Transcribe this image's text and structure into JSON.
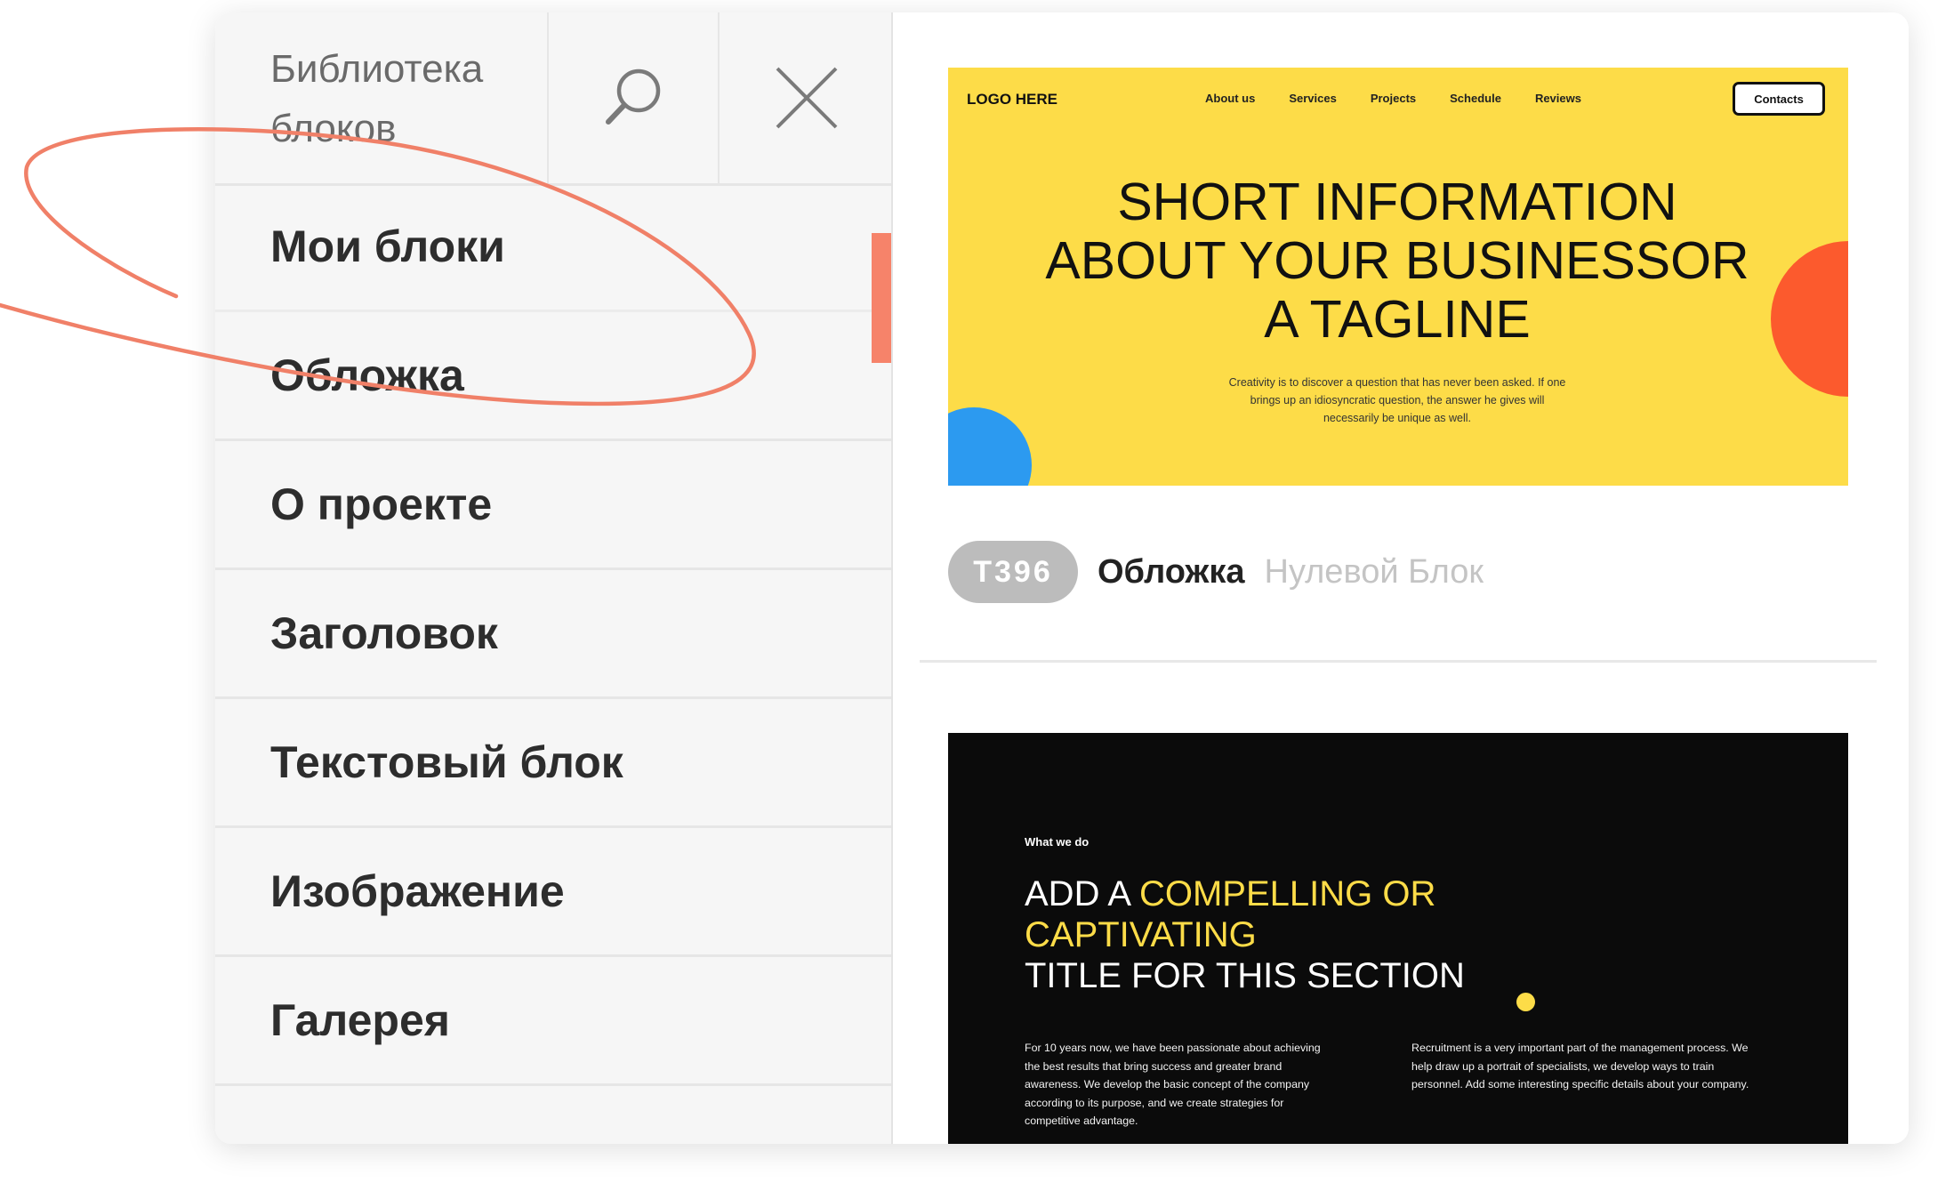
{
  "sidebar": {
    "title": "Библиотека блоков",
    "search_icon": "search-icon",
    "close_icon": "close-icon",
    "accent_color": "#f6836a",
    "items": [
      {
        "label": "Мои блоки",
        "active": true
      },
      {
        "label": "Обложка"
      },
      {
        "label": "О проекте"
      },
      {
        "label": "Заголовок"
      },
      {
        "label": "Текстовый блок"
      },
      {
        "label": "Изображение"
      },
      {
        "label": "Галерея"
      }
    ]
  },
  "blocks": [
    {
      "code": "T396",
      "title": "Обложка",
      "subtitle": "Нулевой Блок",
      "preview": {
        "logo": "LOGO HERE",
        "nav": [
          "About us",
          "Services",
          "Projects",
          "Schedule",
          "Reviews"
        ],
        "button": "Contacts",
        "headline": "SHORT INFORMATION ABOUT YOUR BUSINESSOR A TAGLINE",
        "description": "Creativity is to discover a question that has never been asked. If one brings up an idiosyncratic question, the answer he gives will necessarily be unique as well.",
        "colors": {
          "background": "#fddc48",
          "circle_orange": "#fc5a2d",
          "circle_blue": "#2c9af0"
        }
      }
    },
    {
      "preview": {
        "kicker": "What we do",
        "title_part1": "ADD A ",
        "title_highlight": "COMPELLING OR CAPTIVATING",
        "title_part2": "TITLE FOR THIS SECTION",
        "col1": "For 10 years now, we have been passionate about achieving the best results that bring success and greater brand awareness. We develop the basic concept of the company according to its purpose, and we create strategies for competitive advantage.",
        "col2": "Recruitment is a very important part of the management process. We help draw up a portrait of specialists, we develop ways to train personnel. Add some interesting specific details about your company.",
        "colors": {
          "background": "#0b0b0b",
          "highlight": "#fddc48"
        }
      }
    }
  ]
}
